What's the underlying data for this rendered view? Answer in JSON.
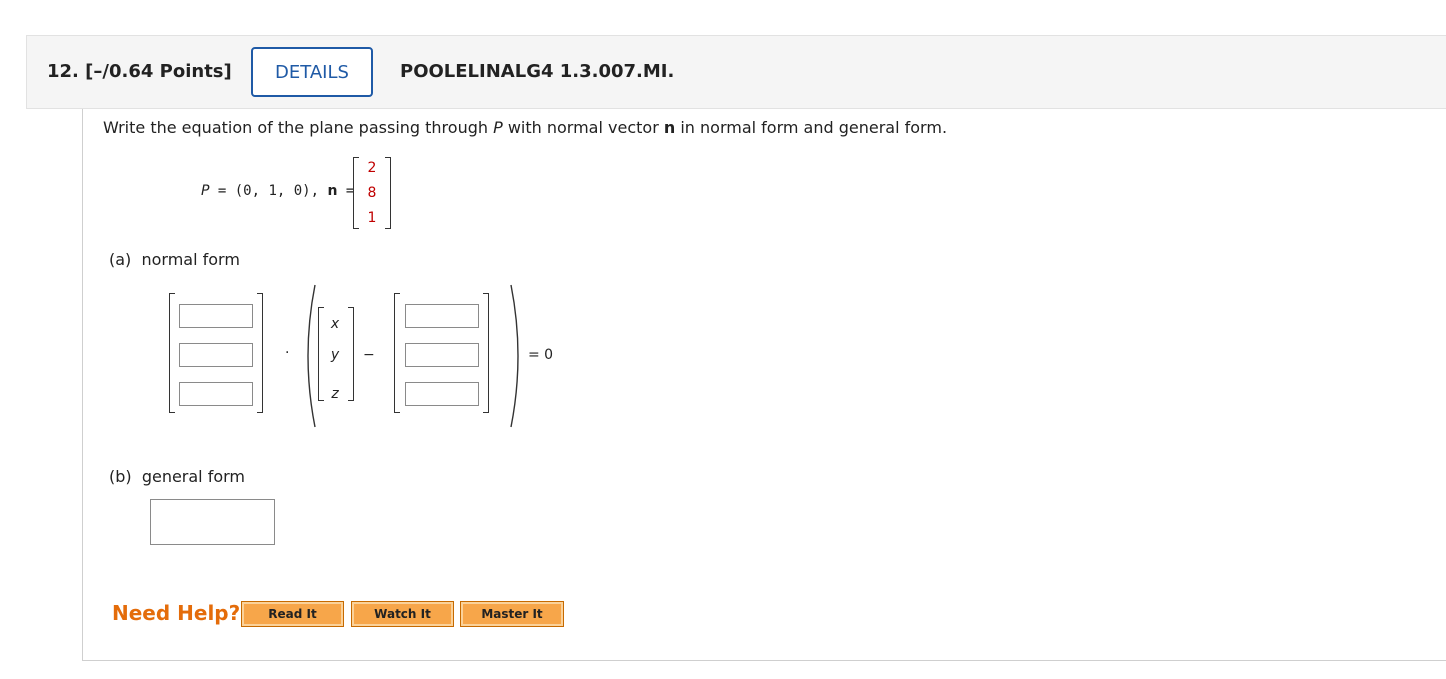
{
  "header": {
    "question_number": "12.",
    "points": "[–/0.64 Points]",
    "details_label": "DETAILS",
    "question_code": "POOLELINALG4 1.3.007.MI."
  },
  "prompt": {
    "before_p": "Write the equation of the plane passing through ",
    "p_symbol": "P",
    "middle": " with normal vector ",
    "n_symbol": "n",
    "after": " in normal form and general form."
  },
  "given": {
    "p_symbol": "P",
    "p_value": " = (0, 1, 0), ",
    "n_symbol": "n",
    "n_equals": " =",
    "n_vector": [
      "2",
      "8",
      "1"
    ]
  },
  "part_a": {
    "letter": "(a)",
    "label": "normal form",
    "variables": [
      "x",
      "y",
      "z"
    ],
    "dot": "·",
    "minus": "−",
    "equals_zero": "= 0"
  },
  "part_b": {
    "letter": "(b)",
    "label": "general form"
  },
  "help": {
    "label": "Need Help?",
    "buttons": [
      "Read It",
      "Watch It",
      "Master It"
    ]
  },
  "colors": {
    "accent": "#1f5aa6",
    "need_help": "#e46c0a",
    "vector_values": "#c00000",
    "help_button": "#f7a64a"
  }
}
